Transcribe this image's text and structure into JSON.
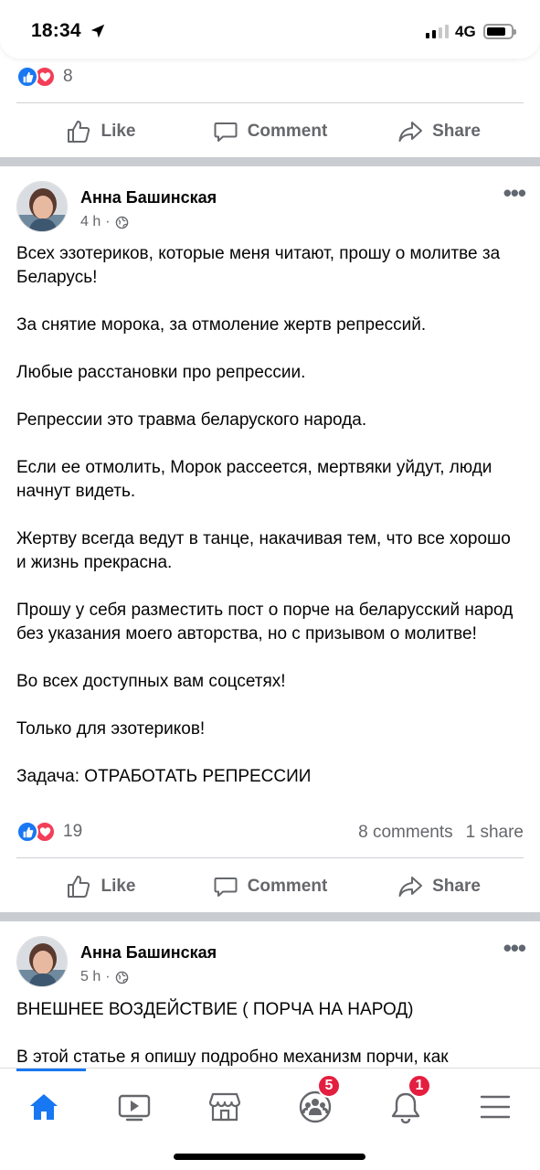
{
  "status": {
    "time": "18:34",
    "network": "4G"
  },
  "prev_post": {
    "reaction_count": "8"
  },
  "actions": {
    "like": "Like",
    "comment": "Comment",
    "share": "Share"
  },
  "post1": {
    "author": "Анна Башинская",
    "time": "4 h",
    "paragraphs": [
      "Всех эзотериков, которые меня читают, прошу о молитве за Беларусь!",
      "За снятие морока, за отмоление жертв репрессий.",
      "Любые расстановки про репрессии.",
      "Репрессии это травма беларуского народа.",
      "Если ее отмолить, Морок рассеется, мертвяки уйдут, люди начнут видеть.",
      "Жертву всегда ведут в танце, накачивая тем, что все хорошо и жизнь прекрасна.",
      "Прошу у себя разместить пост о порче на беларусский народ без указания моего авторства, но с призывом о молитве!",
      "Во всех доступных вам соцсетях!",
      "Только для эзотериков!",
      "Задача: ОТРАБОТАТЬ РЕПРЕССИИ"
    ],
    "reaction_count": "19",
    "comments": "8 comments",
    "shares": "1 share"
  },
  "post2": {
    "author": "Анна Башинская",
    "time": "5 h",
    "paragraphs": [
      "ВНЕШНЕЕ ВОЗДЕЙСТВИЕ ( ПОРЧА НА НАРОД)",
      "В этой статье я опишу подробно механизм порчи, как"
    ]
  },
  "tabbar": {
    "items": [
      {
        "icon": "home-icon",
        "active": true
      },
      {
        "icon": "video-icon"
      },
      {
        "icon": "marketplace-icon"
      },
      {
        "icon": "groups-icon",
        "badge": "5"
      },
      {
        "icon": "bell-icon",
        "badge": "1"
      },
      {
        "icon": "menu-icon"
      }
    ]
  },
  "colors": {
    "accent": "#1877f2",
    "love": "#f33e58",
    "badge": "#e41e3f",
    "muted": "#65676b"
  }
}
